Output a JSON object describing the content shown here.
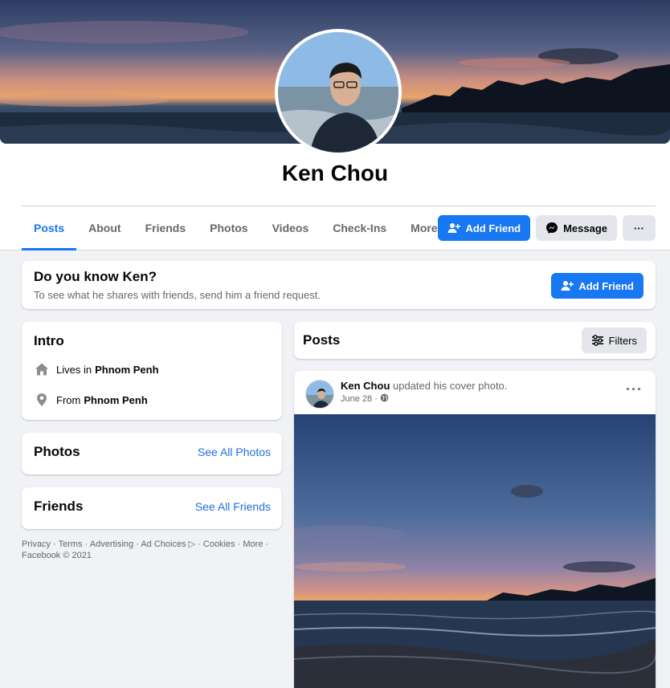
{
  "profile": {
    "name": "Ken Chou"
  },
  "nav": {
    "items": [
      "Posts",
      "About",
      "Friends",
      "Photos",
      "Videos",
      "Check-Ins",
      "More"
    ],
    "active": "Posts"
  },
  "actions": {
    "add_friend": "Add Friend",
    "message": "Message",
    "more": "···"
  },
  "know_card": {
    "title": "Do you know Ken?",
    "subtitle": "To see what he shares with friends, send him a friend request.",
    "button": "Add Friend"
  },
  "intro": {
    "title": "Intro",
    "lives_prefix": "Lives in",
    "lives_place": "Phnom Penh",
    "from_prefix": "From",
    "from_place": "Phnom Penh"
  },
  "photos": {
    "title": "Photos",
    "link": "See All Photos"
  },
  "friends": {
    "title": "Friends",
    "link": "See All Friends"
  },
  "footer": {
    "line1": "Privacy · Terms · Advertising · Ad Choices ▷ · Cookies · More ·",
    "line2": "Facebook © 2021"
  },
  "posts": {
    "title": "Posts",
    "filters": "Filters"
  },
  "post": {
    "author": "Ken Chou",
    "action": "updated his cover photo.",
    "date": "June 28 ·",
    "more": "···"
  },
  "colors": {
    "accent": "#1877f2",
    "background": "#f0f2f5",
    "link": "#216fdb"
  }
}
